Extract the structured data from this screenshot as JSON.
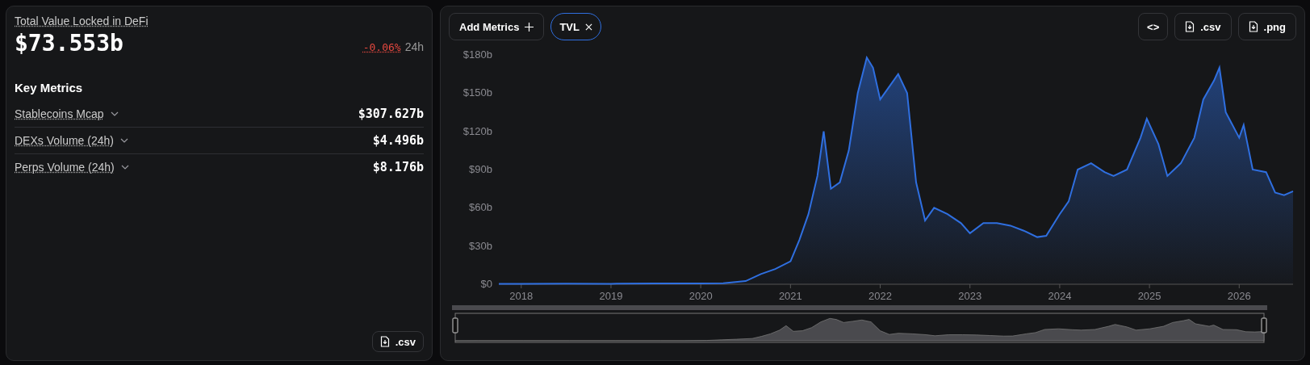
{
  "summary": {
    "title": "Total Value Locked in DeFi",
    "value": "$73.553b",
    "change": "-0.06%",
    "change_period": "24h",
    "section_title": "Key Metrics",
    "metrics": [
      {
        "label": "Stablecoins Mcap",
        "value": "$307.627b"
      },
      {
        "label": "DEXs Volume (24h)",
        "value": "$4.496b"
      },
      {
        "label": "Perps Volume (24h)",
        "value": "$8.176b"
      }
    ],
    "download_label": ".csv"
  },
  "chart_panel": {
    "add_button": "Add Metrics",
    "chips": [
      {
        "label": "TVL",
        "selected": true
      }
    ],
    "embed_label": "<>",
    "downloads": [
      ".csv",
      ".png"
    ],
    "chart_data": {
      "type": "area",
      "x": [
        2017.75,
        2018.0,
        2018.5,
        2019.0,
        2019.5,
        2020.0,
        2020.25,
        2020.5,
        2020.67,
        2020.83,
        2021.0,
        2021.1,
        2021.2,
        2021.3,
        2021.37,
        2021.45,
        2021.55,
        2021.65,
        2021.75,
        2021.85,
        2021.92,
        2022.0,
        2022.1,
        2022.2,
        2022.3,
        2022.4,
        2022.5,
        2022.6,
        2022.75,
        2022.9,
        2023.0,
        2023.15,
        2023.3,
        2023.45,
        2023.6,
        2023.75,
        2023.85,
        2024.0,
        2024.1,
        2024.2,
        2024.35,
        2024.5,
        2024.6,
        2024.75,
        2024.9,
        2024.97,
        2025.1,
        2025.2,
        2025.35,
        2025.5,
        2025.6,
        2025.72,
        2025.78,
        2025.85,
        2026.0,
        2026.05,
        2026.15,
        2026.3,
        2026.4,
        2026.5,
        2026.6
      ],
      "series": [
        {
          "color": "#2f6fe0",
          "values": [
            0.3,
            0.4,
            0.5,
            0.4,
            0.6,
            0.7,
            0.8,
            2.5,
            8,
            12,
            18,
            35,
            55,
            85,
            120,
            75,
            80,
            105,
            150,
            178,
            170,
            145,
            155,
            165,
            150,
            80,
            50,
            60,
            55,
            48,
            40,
            48,
            48,
            46,
            42,
            37,
            38,
            55,
            65,
            90,
            95,
            88,
            85,
            90,
            115,
            130,
            110,
            85,
            95,
            115,
            145,
            160,
            170,
            135,
            115,
            125,
            90,
            88,
            72,
            70,
            73
          ]
        }
      ],
      "xlim": [
        2017.75,
        2026.6
      ],
      "ylim": [
        0,
        180
      ],
      "xticks": [
        2018,
        2019,
        2020,
        2021,
        2022,
        2023,
        2024,
        2025,
        2026
      ],
      "yticks": [
        {
          "value": 0,
          "label": "$0"
        },
        {
          "value": 30,
          "label": "$30b"
        },
        {
          "value": 60,
          "label": "$60b"
        },
        {
          "value": 90,
          "label": "$90b"
        },
        {
          "value": 120,
          "label": "$120b"
        },
        {
          "value": 150,
          "label": "$150b"
        },
        {
          "value": 180,
          "label": "$180b"
        }
      ]
    }
  }
}
